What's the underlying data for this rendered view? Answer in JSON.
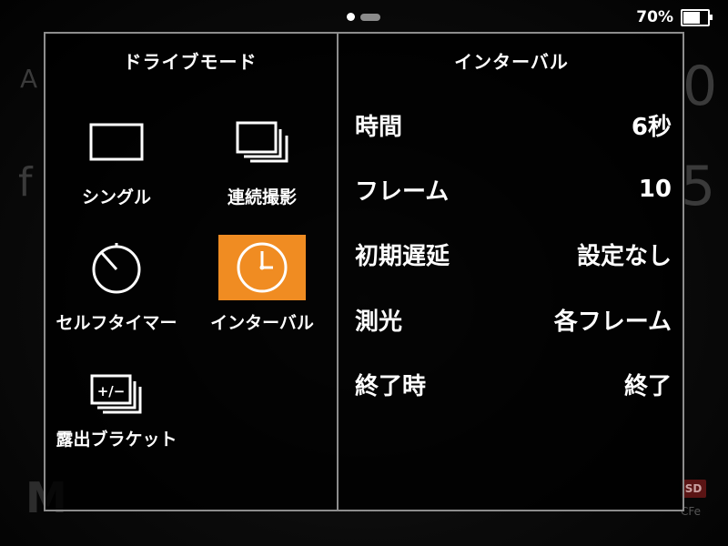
{
  "status": {
    "battery_percent": "70%",
    "battery_level": 0.7
  },
  "left_panel": {
    "title": "ドライブモード",
    "modes": [
      {
        "label": "シングル",
        "icon": "single-frame-icon",
        "selected": false
      },
      {
        "label": "連続撮影",
        "icon": "continuous-shooting-icon",
        "selected": false
      },
      {
        "label": "セルフタイマー",
        "icon": "self-timer-icon",
        "selected": false
      },
      {
        "label": "インターバル",
        "icon": "interval-clock-icon",
        "selected": true
      },
      {
        "label": "露出ブラケット",
        "icon": "exposure-bracket-icon",
        "selected": false
      }
    ]
  },
  "right_panel": {
    "title": "インターバル",
    "settings": [
      {
        "label": "時間",
        "value": "6秒"
      },
      {
        "label": "フレーム",
        "value": "10"
      },
      {
        "label": "初期遅延",
        "value": "設定なし"
      },
      {
        "label": "測光",
        "value": "各フレーム"
      },
      {
        "label": "終了時",
        "value": "終了"
      }
    ]
  },
  "background_overlay": {
    "sd_badge": "SD",
    "cfe_badge": "CFe"
  },
  "colors": {
    "accent": "#f08c22",
    "border": "#8d8d8d",
    "text": "#ffffff"
  }
}
